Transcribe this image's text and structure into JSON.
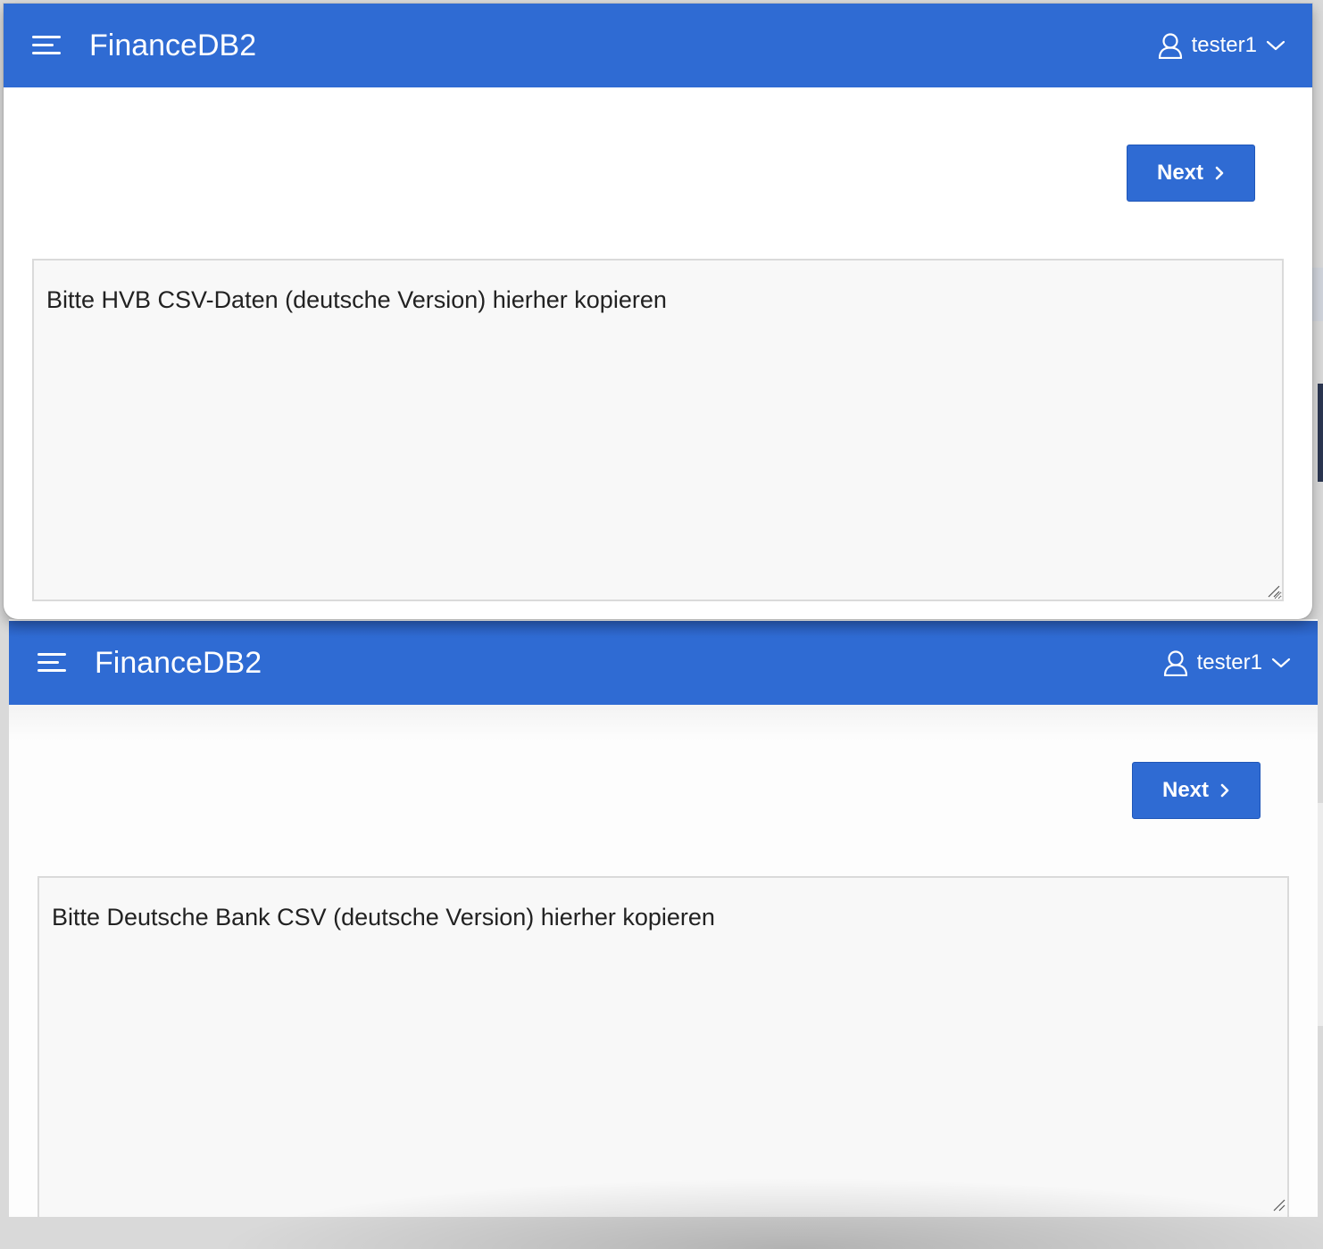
{
  "windows": [
    {
      "header": {
        "menu_icon": "hamburger-menu-icon",
        "app_title": "FinanceDB2",
        "user_icon": "user-icon",
        "user_name": "tester1",
        "dropdown_icon": "chevron-down-icon"
      },
      "toolbar": {
        "next_label": "Next",
        "next_icon": "chevron-right-icon"
      },
      "csv_input": {
        "placeholder": "Bitte HVB CSV-Daten (deutsche Version) hierher kopieren",
        "value": ""
      }
    },
    {
      "header": {
        "menu_icon": "hamburger-menu-icon",
        "app_title": "FinanceDB2",
        "user_icon": "user-icon",
        "user_name": "tester1",
        "dropdown_icon": "chevron-down-icon"
      },
      "toolbar": {
        "next_label": "Next",
        "next_icon": "chevron-right-icon"
      },
      "csv_input": {
        "placeholder": "Bitte Deutsche Bank CSV (deutsche Version) hierher kopieren",
        "value": ""
      }
    }
  ],
  "colors": {
    "header_blue": "#2f6bd3",
    "button_blue": "#2f6bd3",
    "text_dark": "#222222",
    "textarea_bg": "#f8f8f8",
    "textarea_border": "#dadada"
  }
}
